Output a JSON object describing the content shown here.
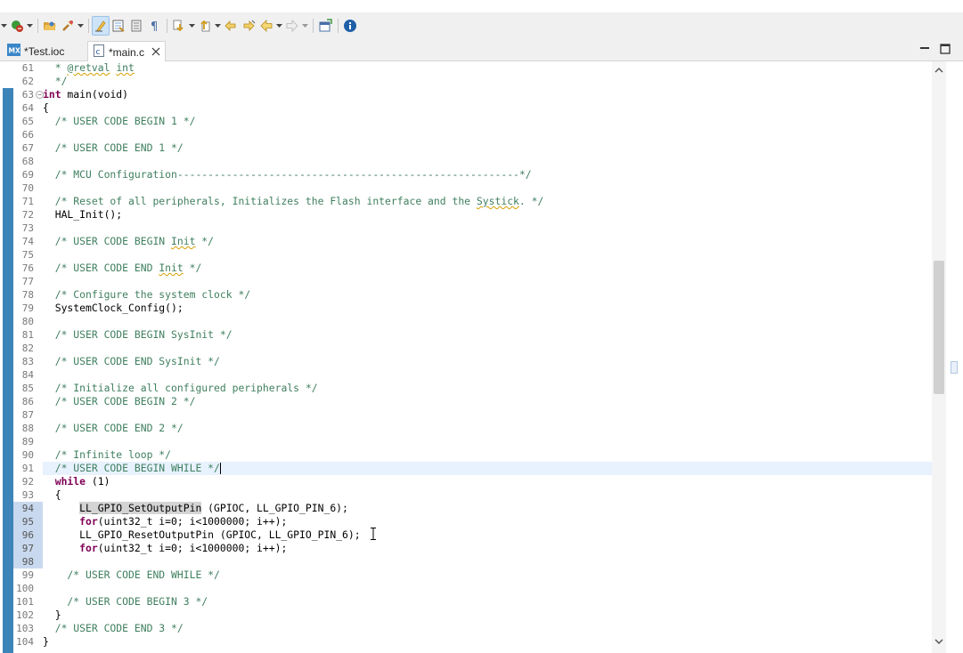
{
  "toolbar": {
    "icons": [
      "dropdown-arrow",
      "debug-run-icon",
      "open-folder-icon",
      "build-tool-icon",
      "toggle-mark-occurrences-icon",
      "toggle-block-selection-icon",
      "show-whitespace-icon",
      "pilcrow-icon",
      "next-annotation-icon",
      "previous-annotation-icon",
      "last-edit-location-icon",
      "next-edit-icon",
      "back-icon",
      "forward-icon",
      "open-perspective-icon",
      "info-icon"
    ]
  },
  "tabs": [
    {
      "icon": "MX",
      "label": "*Test.ioc",
      "active": false
    },
    {
      "icon": "c",
      "label": "*main.c",
      "active": true
    }
  ],
  "editor": {
    "current_line": 91,
    "lines": [
      {
        "n": "61",
        "text": "  * @retval int"
      },
      {
        "n": "62",
        "text": "  */"
      },
      {
        "n": "63",
        "text": "int main(void)"
      },
      {
        "n": "64",
        "text": "{"
      },
      {
        "n": "65",
        "text": "  /* USER CODE BEGIN 1 */"
      },
      {
        "n": "66",
        "text": ""
      },
      {
        "n": "67",
        "text": "  /* USER CODE END 1 */"
      },
      {
        "n": "68",
        "text": ""
      },
      {
        "n": "69",
        "text": "  /* MCU Configuration--------------------------------------------------------*/"
      },
      {
        "n": "70",
        "text": ""
      },
      {
        "n": "71",
        "text": "  /* Reset of all peripherals, Initializes the Flash interface and the Systick. */"
      },
      {
        "n": "72",
        "text": "  HAL_Init();"
      },
      {
        "n": "73",
        "text": ""
      },
      {
        "n": "74",
        "text": "  /* USER CODE BEGIN Init */"
      },
      {
        "n": "75",
        "text": ""
      },
      {
        "n": "76",
        "text": "  /* USER CODE END Init */"
      },
      {
        "n": "77",
        "text": ""
      },
      {
        "n": "78",
        "text": "  /* Configure the system clock */"
      },
      {
        "n": "79",
        "text": "  SystemClock_Config();"
      },
      {
        "n": "80",
        "text": ""
      },
      {
        "n": "81",
        "text": "  /* USER CODE BEGIN SysInit */"
      },
      {
        "n": "82",
        "text": ""
      },
      {
        "n": "83",
        "text": "  /* USER CODE END SysInit */"
      },
      {
        "n": "84",
        "text": ""
      },
      {
        "n": "85",
        "text": "  /* Initialize all configured peripherals */"
      },
      {
        "n": "86",
        "text": "  /* USER CODE BEGIN 2 */"
      },
      {
        "n": "87",
        "text": ""
      },
      {
        "n": "88",
        "text": "  /* USER CODE END 2 */"
      },
      {
        "n": "89",
        "text": ""
      },
      {
        "n": "90",
        "text": "  /* Infinite loop */"
      },
      {
        "n": "91",
        "text": "  /* USER CODE BEGIN WHILE */"
      },
      {
        "n": "92",
        "text": "  while (1)"
      },
      {
        "n": "93",
        "text": "  {"
      },
      {
        "n": "94",
        "text": "      LL_GPIO_SetOutputPin (GPIOC, LL_GPIO_PIN_6);"
      },
      {
        "n": "95",
        "text": "      for(uint32_t i=0; i<1000000; i++);"
      },
      {
        "n": "96",
        "text": "      LL_GPIO_ResetOutputPin (GPIOC, LL_GPIO_PIN_6);"
      },
      {
        "n": "97",
        "text": "      for(uint32_t i=0; i<1000000; i++);"
      },
      {
        "n": "98",
        "text": ""
      },
      {
        "n": "99",
        "text": "    /* USER CODE END WHILE */"
      },
      {
        "n": "100",
        "text": ""
      },
      {
        "n": "101",
        "text": "    /* USER CODE BEGIN 3 */"
      },
      {
        "n": "102",
        "text": "  }"
      },
      {
        "n": "103",
        "text": "  /* USER CODE END 3 */"
      },
      {
        "n": "104",
        "text": "}"
      }
    ]
  },
  "colors": {
    "comment": "#3f7f5f",
    "keyword": "#7f0055",
    "ruler": "#3d84b8",
    "current_line": "#e8f2fe",
    "selected_line_numbers": "#c8d8ee"
  }
}
